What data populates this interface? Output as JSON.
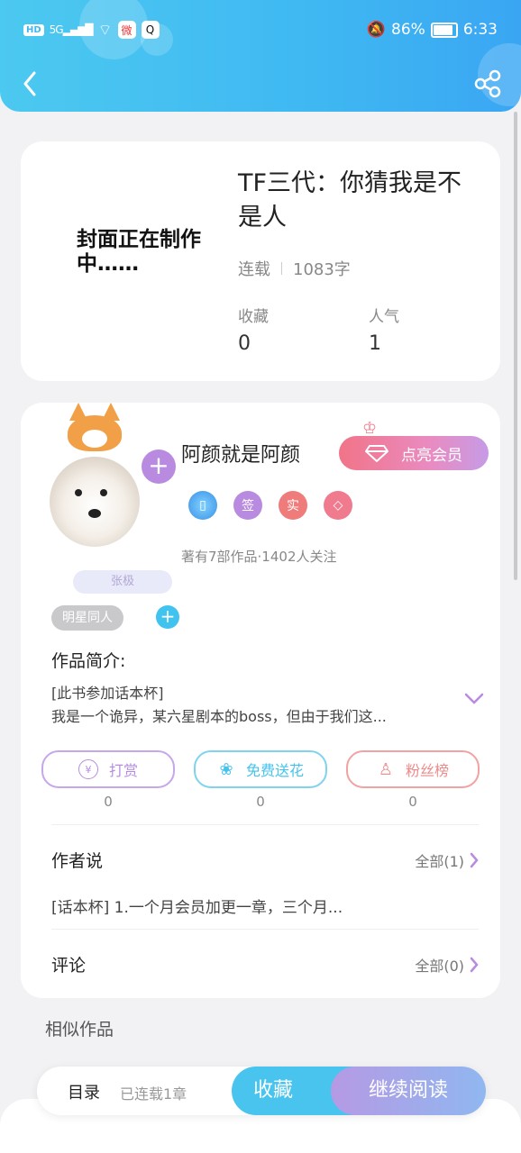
{
  "status_bar": {
    "left": {
      "hd": "HD",
      "signal": "5G",
      "weibo_icon": "微",
      "qq_icon": "Q"
    },
    "battery": "86%",
    "time": "6:33"
  },
  "book": {
    "cover_text": "封面正在制作中……",
    "title": "TF三代：你猜我是不是人",
    "status": "连载",
    "word_count": "1083字",
    "stats": [
      {
        "label": "收藏",
        "value": "0"
      },
      {
        "label": "人气",
        "value": "1"
      }
    ]
  },
  "author": {
    "name": "阿颜就是阿颜",
    "avatar_tag": "张极",
    "follow_plus": "+",
    "vip_button": "点亮会员",
    "badges": [
      {
        "icon": "phone-badge-icon",
        "text": "",
        "color": "#4aa8f0"
      },
      {
        "icon": "sign-badge-icon",
        "text": "签",
        "color": "#b98be0"
      },
      {
        "icon": "verified-badge-icon",
        "text": "实",
        "color": "#f07b7b"
      },
      {
        "icon": "diamond-badge-icon",
        "text": "",
        "color": "#f07b8f"
      }
    ],
    "works_info": "著有7部作品·1402人关注"
  },
  "tags": {
    "chip": "明星同人",
    "add": "+"
  },
  "intro": {
    "label": "作品简介:",
    "line1": "[此书参加话本杯]",
    "line2": "我是一个诡异，某六星剧本的boss，但由于我们这..."
  },
  "actions": [
    {
      "label": "打赏",
      "icon": "¥",
      "count": "0",
      "color": "#b58de0"
    },
    {
      "label": "免费送花",
      "icon": "❀",
      "count": "0",
      "color": "#46c3ec"
    },
    {
      "label": "粉丝榜",
      "icon": "♙",
      "count": "0",
      "color": "#ee8a8a"
    }
  ],
  "author_says": {
    "title": "作者说",
    "more": "全部(1)",
    "text": "[话本杯] 1.一个月会员加更一章，三个月..."
  },
  "comments": {
    "title": "评论",
    "more": "全部(0)"
  },
  "similar": {
    "title": "相似作品"
  },
  "bottom_bar": {
    "toc": "目录",
    "toc_sub": "已连载1章",
    "collect": "收藏",
    "read": "继续阅读"
  }
}
